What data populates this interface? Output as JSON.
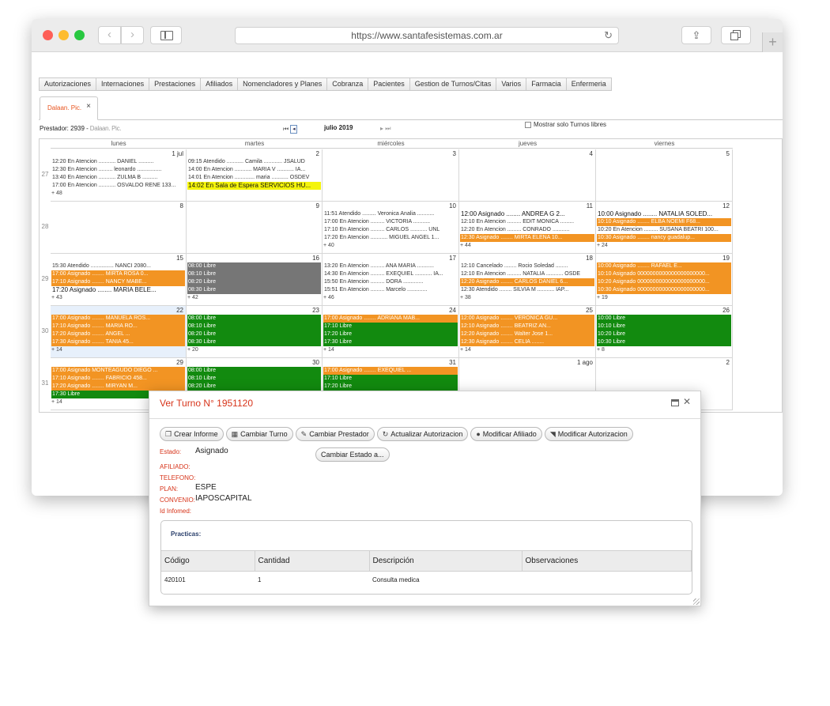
{
  "browser": {
    "url": "https://www.santafesistemas.com.ar"
  },
  "menu": [
    "Autorizaciones",
    "Internaciones",
    "Prestaciones",
    "Afiliados",
    "Nomencladores y Planes",
    "Cobranza",
    "Pacientes",
    "Gestion de Turnos/Citas",
    "Varios",
    "Farmacia",
    "Enfermeria"
  ],
  "app_tab": {
    "label": "Dalaan. Pic."
  },
  "toolbar": {
    "prestador_label": "Prestador: 2939 -",
    "prestador_name": " Dalaan. Pic.",
    "month_title": "julio 2019",
    "free_only_label": "Mostrar solo Turnos libres"
  },
  "calendar": {
    "day_headers": [
      "lunes",
      "martes",
      "miércoles",
      "jueves",
      "viernes"
    ],
    "week_numbers": [
      "27",
      "28",
      "29",
      "30",
      "31"
    ],
    "weeks": [
      [
        {
          "day": "1 jul",
          "entries": [
            {
              "t": "12:20 En Atencion ........... DANIEL ..........",
              "c": "plain"
            },
            {
              "t": "12:30 En Atencion ......... leonardo ................",
              "c": "plain"
            },
            {
              "t": "13:40 En Atencion ........... ZULMA B ..........",
              "c": "plain"
            },
            {
              "t": "17:00 En Atencion ........... OSVALDO RENE 133...",
              "c": "plain"
            }
          ],
          "more": "+ 48"
        },
        {
          "day": "2",
          "entries": [
            {
              "t": "09:15 Atendido ........... Camila ............ JSALUD",
              "c": "plain"
            },
            {
              "t": "14:00 En Atencion ........... MARIA V ........... IA...",
              "c": "plain"
            },
            {
              "t": "14:01 En Atencion ............. maria ........... OSDEV",
              "c": "plain"
            },
            {
              "t": "14:02 En Sala de Espera SERVICIOS HU...",
              "c": "yellow"
            }
          ],
          "more": ""
        },
        {
          "day": "3",
          "entries": [],
          "more": ""
        },
        {
          "day": "4",
          "entries": [],
          "more": ""
        },
        {
          "day": "5",
          "entries": [],
          "more": ""
        }
      ],
      [
        {
          "day": "8",
          "entries": [],
          "more": ""
        },
        {
          "day": "9",
          "entries": [],
          "more": ""
        },
        {
          "day": "10",
          "entries": [
            {
              "t": "11:51 Atendido ......... Veronica Analia ...........",
              "c": "plain"
            },
            {
              "t": "17:00 En Atencion ......... VICTORIA ...........",
              "c": "plain"
            },
            {
              "t": "17:10 En Atencion ......... CARLOS ........... UNL",
              "c": "plain"
            },
            {
              "t": "17:20 En Atencion ........... MIGUEL ANGEL 1...",
              "c": "plain"
            }
          ],
          "more": "+ 40"
        },
        {
          "day": "11",
          "entries": [
            {
              "t": "12:00 Asignado ........ ANDREA G 2...",
              "c": "bold"
            },
            {
              "t": "12:10 En Atencion ......... EDIT MONICA .........",
              "c": "plain"
            },
            {
              "t": "12:20 En Atencion ......... CONRADO ...........",
              "c": "plain"
            },
            {
              "t": "12:30 Asignado ........ MIRTA ELENA 10...",
              "c": "orange"
            }
          ],
          "more": "+ 44"
        },
        {
          "day": "12",
          "entries": [
            {
              "t": "10:00 Asignado ........ NATALIA SOLED...",
              "c": "bold"
            },
            {
              "t": "10:10 Asignado ........ ELBA NOEMI F68...",
              "c": "orange"
            },
            {
              "t": "10:20 En Atencion ......... SUSANA BEATRI 100...",
              "c": "plain"
            },
            {
              "t": "10:30 Asignado ........ nancy guadalup...",
              "c": "orange"
            }
          ],
          "more": "+ 24"
        }
      ],
      [
        {
          "day": "15",
          "entries": [
            {
              "t": "15:30 Atendido ............... NANCI 2080...",
              "c": "plain"
            },
            {
              "t": "17:00 Asignado ........ MIRTA ROSA 0...",
              "c": "orange"
            },
            {
              "t": "17:10 Asignado ........ NANCY MABE...",
              "c": "orange"
            },
            {
              "t": "17:20 Asignado ........ MARIA BELE...",
              "c": "bold"
            }
          ],
          "more": "+ 43"
        },
        {
          "day": "16",
          "entries": [
            {
              "t": "08:00 Libre",
              "c": "gray"
            },
            {
              "t": "08:10 Libre",
              "c": "gray"
            },
            {
              "t": "08:20 Libre",
              "c": "gray"
            },
            {
              "t": "08:30 Libre",
              "c": "gray"
            }
          ],
          "more": "+ 42"
        },
        {
          "day": "17",
          "entries": [
            {
              "t": "13:20 En Atencion ......... ANA MARIA ...........",
              "c": "plain"
            },
            {
              "t": "14:30 En Atencion ......... EXEQUIEL ........... IA...",
              "c": "plain"
            },
            {
              "t": "15:50 En Atencion ......... DORA .............",
              "c": "plain"
            },
            {
              "t": "15:51 En Atencion ......... Marcelo .............",
              "c": "plain"
            }
          ],
          "more": "+ 46"
        },
        {
          "day": "18",
          "entries": [
            {
              "t": "12:10 Cancelado ........ Rocio Soledad ........",
              "c": "plain"
            },
            {
              "t": "12:10 En Atencion ......... NATALIA ........... OSDE",
              "c": "plain"
            },
            {
              "t": "12:20 Asignado ........ CARLOS DANIEL 6...",
              "c": "orange"
            },
            {
              "t": "12:30 Atendido ........ SILVIA M ........... IAP...",
              "c": "plain"
            }
          ],
          "more": "+ 38"
        },
        {
          "day": "19",
          "entries": [
            {
              "t": "10:00 Asignado ........ RAFAEL E...",
              "c": "orange"
            },
            {
              "t": "10:10 Asignado 0000000000000000000000...",
              "c": "orange"
            },
            {
              "t": "10:20 Asignado 0000000000000000000000...",
              "c": "orange"
            },
            {
              "t": "10:30 Asignado 0000000000000000000000...",
              "c": "orange"
            }
          ],
          "more": "+ 19"
        }
      ],
      [
        {
          "day": "22",
          "today": true,
          "entries": [
            {
              "t": "17:00 Asignado ........ MANUELA ROS...",
              "c": "orange"
            },
            {
              "t": "17:10 Asignado ........ MARIA RO...",
              "c": "orange"
            },
            {
              "t": "17:20 Asignado ........ ANGEL ...",
              "c": "orange"
            },
            {
              "t": "17:30 Asignado ........ TANIA 45...",
              "c": "orange"
            }
          ],
          "more": "+ 14"
        },
        {
          "day": "23",
          "entries": [
            {
              "t": "08:00 Libre",
              "c": "green"
            },
            {
              "t": "08:10 Libre",
              "c": "green"
            },
            {
              "t": "08:20 Libre",
              "c": "green"
            },
            {
              "t": "08:30 Libre",
              "c": "green"
            }
          ],
          "more": "+ 20"
        },
        {
          "day": "24",
          "entries": [
            {
              "t": "17:00 Asignado ........ ADRIANA MAB...",
              "c": "orange"
            },
            {
              "t": "17:10 Libre",
              "c": "green"
            },
            {
              "t": "17:20 Libre",
              "c": "green"
            },
            {
              "t": "17:30 Libre",
              "c": "green"
            }
          ],
          "more": "+ 14"
        },
        {
          "day": "25",
          "entries": [
            {
              "t": "12:00 Asignado ........ VERONICA GU...",
              "c": "orange"
            },
            {
              "t": "12:10 Asignado ........ BEATRIZ AN...",
              "c": "orange"
            },
            {
              "t": "12:20 Asignado ........ Walter Jose 1...",
              "c": "orange"
            },
            {
              "t": "12:30 Asignado ........ CELIA ........",
              "c": "orange"
            }
          ],
          "more": "+ 14"
        },
        {
          "day": "26",
          "entries": [
            {
              "t": "10:00 Libre",
              "c": "green"
            },
            {
              "t": "10:10 Libre",
              "c": "green"
            },
            {
              "t": "10:20 Libre",
              "c": "green"
            },
            {
              "t": "10:30 Libre",
              "c": "green"
            }
          ],
          "more": "+ 8"
        }
      ],
      [
        {
          "day": "29",
          "entries": [
            {
              "t": "17:00 Asignado MONTEAGUDO DIEGO ...",
              "c": "orange"
            },
            {
              "t": "17:10 Asignado ........ FABRICIO 458...",
              "c": "orange"
            },
            {
              "t": "17:20 Asignado ........ MIRYAN M...",
              "c": "orange"
            },
            {
              "t": "17:30 Libre",
              "c": "green"
            }
          ],
          "more": "+ 14"
        },
        {
          "day": "30",
          "entries": [
            {
              "t": "08:00 Libre",
              "c": "green"
            },
            {
              "t": "08:10 Libre",
              "c": "green"
            },
            {
              "t": "08:20 Libre",
              "c": "green"
            }
          ],
          "more": ""
        },
        {
          "day": "31",
          "entries": [
            {
              "t": "17:00 Asignado ........ EXEQUIEL ...",
              "c": "orange"
            },
            {
              "t": "17:10 Libre",
              "c": "green"
            },
            {
              "t": "17:20 Libre",
              "c": "green"
            }
          ],
          "more": ""
        },
        {
          "day": "1 ago",
          "entries": [],
          "more": ""
        },
        {
          "day": "2",
          "entries": [],
          "more": ""
        }
      ]
    ]
  },
  "dialog": {
    "title": "Ver Turno N° 1951120",
    "buttons": [
      {
        "label": "Crear Informe",
        "icon": "document-icon",
        "glyph": "❐"
      },
      {
        "label": "Cambiar Turno",
        "icon": "calendar-icon",
        "glyph": "▦"
      },
      {
        "label": "Cambiar Prestador",
        "icon": "edit-icon",
        "glyph": "✎"
      },
      {
        "label": "Actualizar Autorizacion",
        "icon": "refresh-icon",
        "glyph": "↻"
      },
      {
        "label": "Modificar Afiliado",
        "icon": "user-icon",
        "glyph": "●"
      },
      {
        "label": "Modificar Autorizacion",
        "icon": "rss-icon",
        "glyph": "◥"
      }
    ],
    "estado_label": "Estado:",
    "estado_value": "Asignado",
    "cambiar_estado": "Cambiar Estado a...",
    "afiliado_label": "AFILIADO:",
    "telefono_label": "TELEFONO:",
    "plan_label": "PLAN:",
    "plan_value": "ESPE",
    "convenio_label": "CONVENIO:",
    "convenio_value": "IAPOSCAPITAL",
    "infomed_label": "Id Infomed:",
    "practicas_title": "Practicas:",
    "columns": [
      "Código",
      "Cantidad",
      "Descripción",
      "Observaciones"
    ],
    "rows": [
      [
        "420101",
        "1",
        "Consulta medica",
        ""
      ]
    ]
  }
}
